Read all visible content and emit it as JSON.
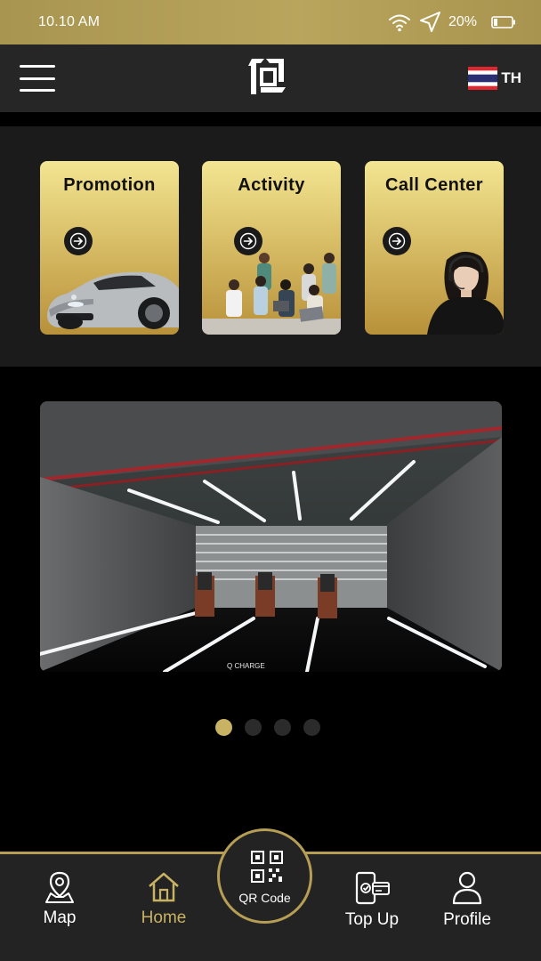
{
  "status_bar": {
    "time": "10.10 AM",
    "battery": "20%"
  },
  "header": {
    "language": "TH"
  },
  "cards": [
    {
      "title": "Promotion",
      "image": "car"
    },
    {
      "title": "Activity",
      "image": "people-group"
    },
    {
      "title": "Call Center",
      "image": "operator"
    }
  ],
  "banner": {
    "image": "charging-station-interior",
    "floor_text": "Q CHARGE",
    "pages": 4,
    "active_page": 1
  },
  "nav": {
    "map": "Map",
    "home": "Home",
    "qr": "QR Code",
    "topup": "Top Up",
    "profile": "Profile"
  },
  "colors": {
    "gold": "#c8b264",
    "dark": "#262626",
    "card_top": "#f3e592",
    "card_bottom": "#b8913a"
  }
}
